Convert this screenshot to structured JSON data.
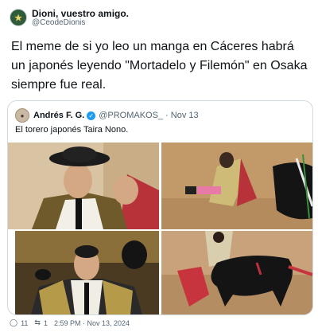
{
  "tweet": {
    "author_name": "Dioni, vuestro amigo.",
    "author_handle": "@CeodeDionis",
    "avatar_icon": "profile-avatar-icon",
    "text": "El meme de si yo leo un manga en Cáceres habrá un japonés leyendo \"Mortadelo y Filemón\" en Osaka siempre fue real."
  },
  "quoted": {
    "author_name": "Andrés F. G.",
    "verified_icon": "verified-badge-icon",
    "author_handle": "@PROMAKOS_",
    "date": "· Nov 13",
    "text": "El torero japonés Taira Nono.",
    "images": [
      "photo-torero-portrait",
      "photo-torero-kneeling-bull",
      "photo-torero-smiling",
      "photo-torero-cape-bull"
    ]
  },
  "footer": {
    "comments": "11",
    "retweets": "1",
    "timestamp": "2:59 PM · Nov 13, 2024"
  },
  "colors": {
    "link_blue": "#1d9bf0",
    "muted": "#536471",
    "border": "#cfd9de"
  }
}
